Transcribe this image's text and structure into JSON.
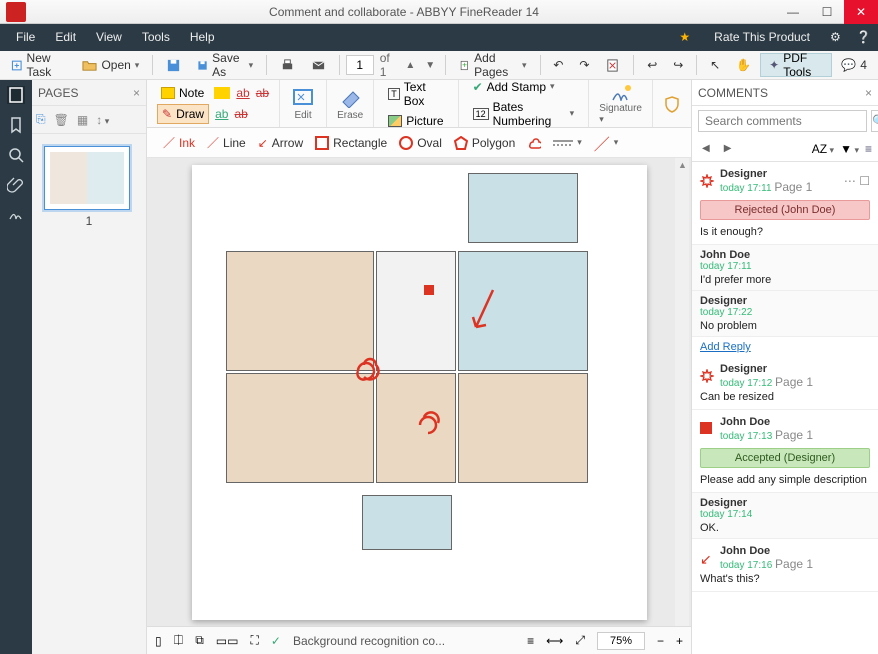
{
  "window": {
    "title": "Comment and collaborate - ABBYY FineReader 14"
  },
  "menu": {
    "file": "File",
    "edit": "Edit",
    "view": "View",
    "tools": "Tools",
    "help": "Help",
    "rate": "Rate This Product"
  },
  "toolbar": {
    "new_task": "New Task",
    "open": "Open",
    "save_as": "Save As",
    "page_of": "of 1",
    "add_pages": "Add Pages",
    "pdf_tools": "PDF Tools",
    "current_page": "1",
    "annot_count": "4"
  },
  "pages_panel": {
    "title": "PAGES",
    "thumb_num": "1"
  },
  "ribbon": {
    "note": "Note",
    "draw": "Draw",
    "edit": "Edit",
    "erase": "Erase",
    "textbox": "Text Box",
    "addstamp": "Add Stamp",
    "picture": "Picture",
    "bates": "Bates Numbering",
    "signature": "Signature"
  },
  "shapes": {
    "ink": "Ink",
    "line": "Line",
    "arrow": "Arrow",
    "rect": "Rectangle",
    "oval": "Oval",
    "poly": "Polygon"
  },
  "footer": {
    "status": "Background recognition co...",
    "zoom": "75%"
  },
  "comments_panel": {
    "title": "COMMENTS",
    "search_ph": "Search comments",
    "sort": "AZ",
    "add_reply": "Add Reply"
  },
  "comments": [
    {
      "icon": "burst",
      "name": "Designer",
      "time": "today 17:11",
      "page": "Page 1",
      "status": "Rejected (John Doe)",
      "status_kind": "rej",
      "text": "Is it enough?"
    },
    {
      "reply": true,
      "name": "John Doe",
      "time": "today 17:11",
      "text": "I'd prefer more"
    },
    {
      "reply": true,
      "name": "Designer",
      "time": "today 17:22",
      "text": "No problem"
    },
    {
      "icon": "burst",
      "name": "Designer",
      "time": "today 17:12",
      "page": "Page 1",
      "text": "Can be resized"
    },
    {
      "icon": "square",
      "name": "John Doe",
      "time": "today 17:13",
      "page": "Page 1",
      "status": "Accepted (Designer)",
      "status_kind": "acc",
      "text": "Please add any simple description"
    },
    {
      "reply": true,
      "name": "Designer",
      "time": "today 17:14",
      "text": "OK."
    },
    {
      "icon": "arrow",
      "name": "John Doe",
      "time": "today 17:16",
      "page": "Page 1",
      "text": "What's this?"
    }
  ]
}
